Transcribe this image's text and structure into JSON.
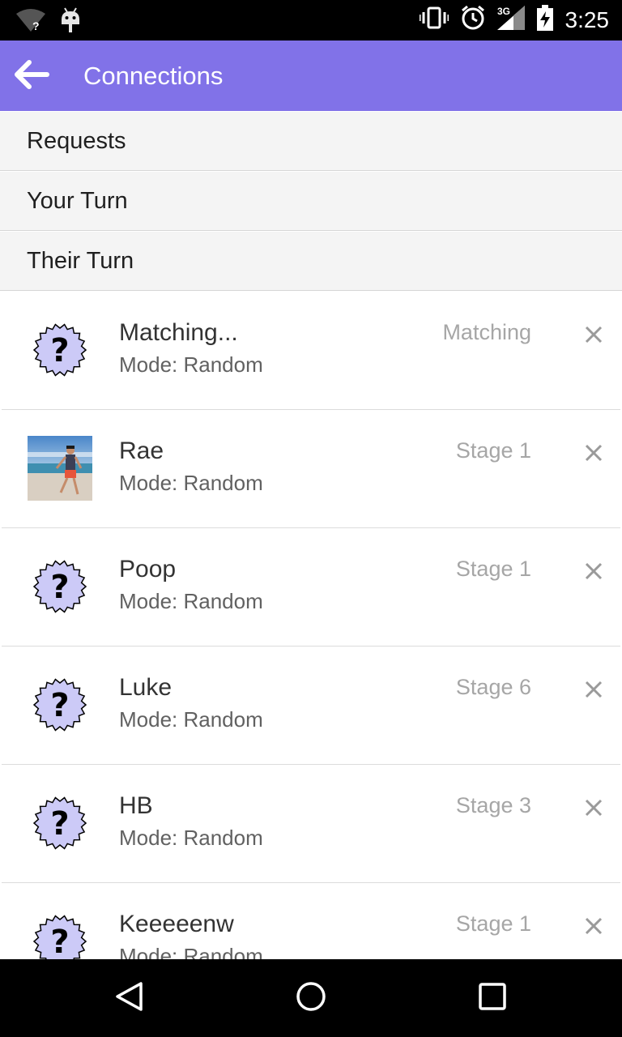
{
  "status_bar": {
    "time": "3:25",
    "network": "3G",
    "wifi_badge": "?",
    "icons": [
      "wifi-unknown-icon",
      "android-icon",
      "vibrate-icon",
      "alarm-icon",
      "signal-3g-icon",
      "battery-charging-icon"
    ]
  },
  "app_bar": {
    "title": "Connections",
    "back_icon": "arrow-left-icon",
    "background_color": "#8172e8"
  },
  "sections": [
    {
      "label": "Requests"
    },
    {
      "label": "Your Turn"
    },
    {
      "label": "Their Turn"
    }
  ],
  "connections": [
    {
      "name": "Matching...",
      "mode": "Mode: Random",
      "status": "Matching",
      "avatar": "question-badge-icon"
    },
    {
      "name": "Rae",
      "mode": "Mode: Random",
      "status": "Stage 1",
      "avatar": "beach-photo"
    },
    {
      "name": "Poop",
      "mode": "Mode: Random",
      "status": "Stage 1",
      "avatar": "question-badge-icon"
    },
    {
      "name": "Luke",
      "mode": "Mode: Random",
      "status": "Stage 6",
      "avatar": "question-badge-icon"
    },
    {
      "name": "HB",
      "mode": "Mode: Random",
      "status": "Stage 3",
      "avatar": "question-badge-icon"
    },
    {
      "name": "Keeeeenw",
      "mode": "Mode: Random",
      "status": "Stage 1",
      "avatar": "question-badge-icon"
    }
  ],
  "nav_bar": {
    "icons": [
      "nav-back-icon",
      "nav-home-icon",
      "nav-recents-icon"
    ]
  },
  "colors": {
    "accent": "#8172e8",
    "badge_fill": "#cccaf7",
    "section_bg": "#f4f4f4"
  }
}
